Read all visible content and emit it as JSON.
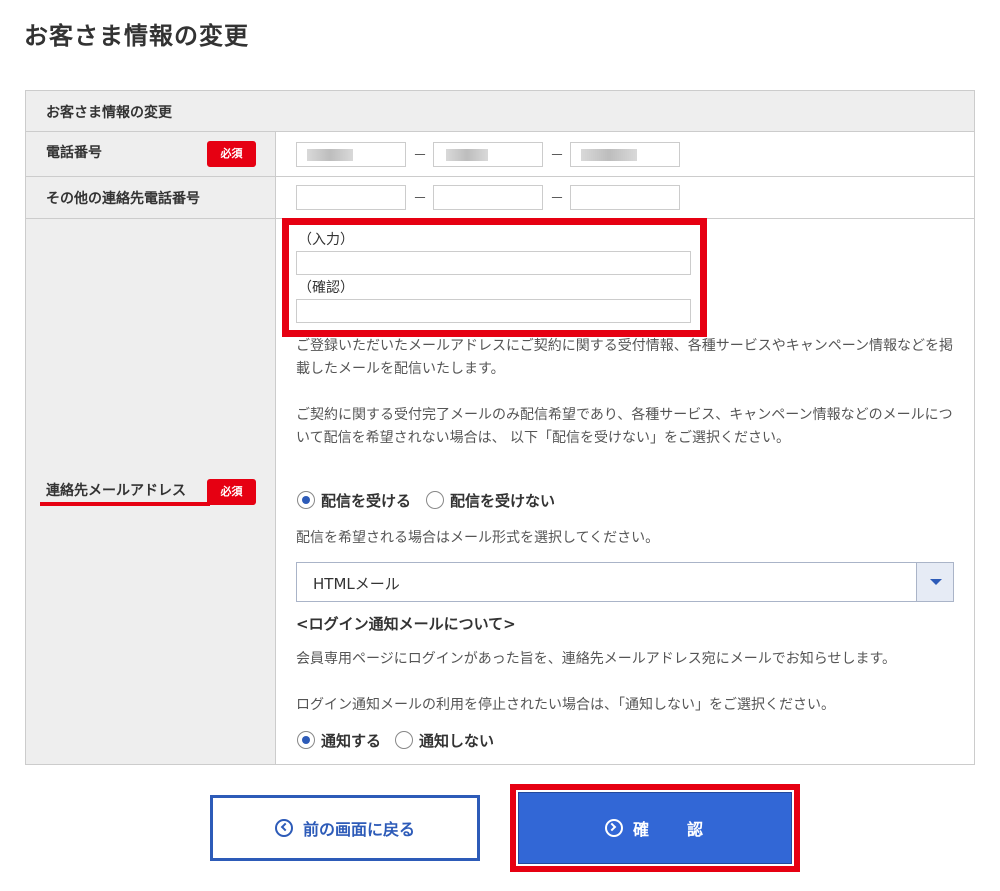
{
  "page": {
    "title": "お客さま情報の変更"
  },
  "section": {
    "header": "お客さま情報の変更"
  },
  "required_badge": "必須",
  "phone": {
    "label": "電話番号",
    "dash": "－"
  },
  "other_phone": {
    "label": "その他の連絡先電話番号"
  },
  "email": {
    "label": "連絡先メールアドレス",
    "input_label": "（入力）",
    "confirm_label": "（確認）",
    "description_1": "ご登録いただいたメールアドレスにご契約に関する受付情報、各種サービスやキャンペーン情報などを掲載したメールを配信いたします。",
    "description_2": "ご契約に関する受付完了メールのみ配信希望であり、各種サービス、キャンペーン情報などのメールについて配信を希望されない場合は、 以下「配信を受けない」をご選択ください。",
    "delivery_options": [
      "配信を受ける",
      "配信を受けない"
    ],
    "delivery_selected": "配信を受ける",
    "format_prompt": "配信を希望される場合はメール形式を選択してください。",
    "format_selected": "HTMLメール",
    "login_heading": "<ログイン通知メールについて>",
    "login_desc_1": "会員専用ページにログインがあった旨を、連絡先メールアドレス宛にメールでお知らせします。",
    "login_desc_2": "ログイン通知メールの利用を停止されたい場合は、「通知しない」をご選択ください。",
    "notify_options": [
      "通知する",
      "通知しない"
    ],
    "notify_selected": "通知する"
  },
  "buttons": {
    "back": "前の画面に戻る",
    "confirm": "確　　認"
  },
  "colors": {
    "accent_blue": "#3267d6",
    "highlight_red": "#e60012",
    "required_red": "#e60012",
    "label_bg": "#eeeeee"
  },
  "icons": {
    "back": "chevron-left-circle-icon",
    "confirm": "chevron-right-circle-icon",
    "select": "caret-down-icon"
  }
}
